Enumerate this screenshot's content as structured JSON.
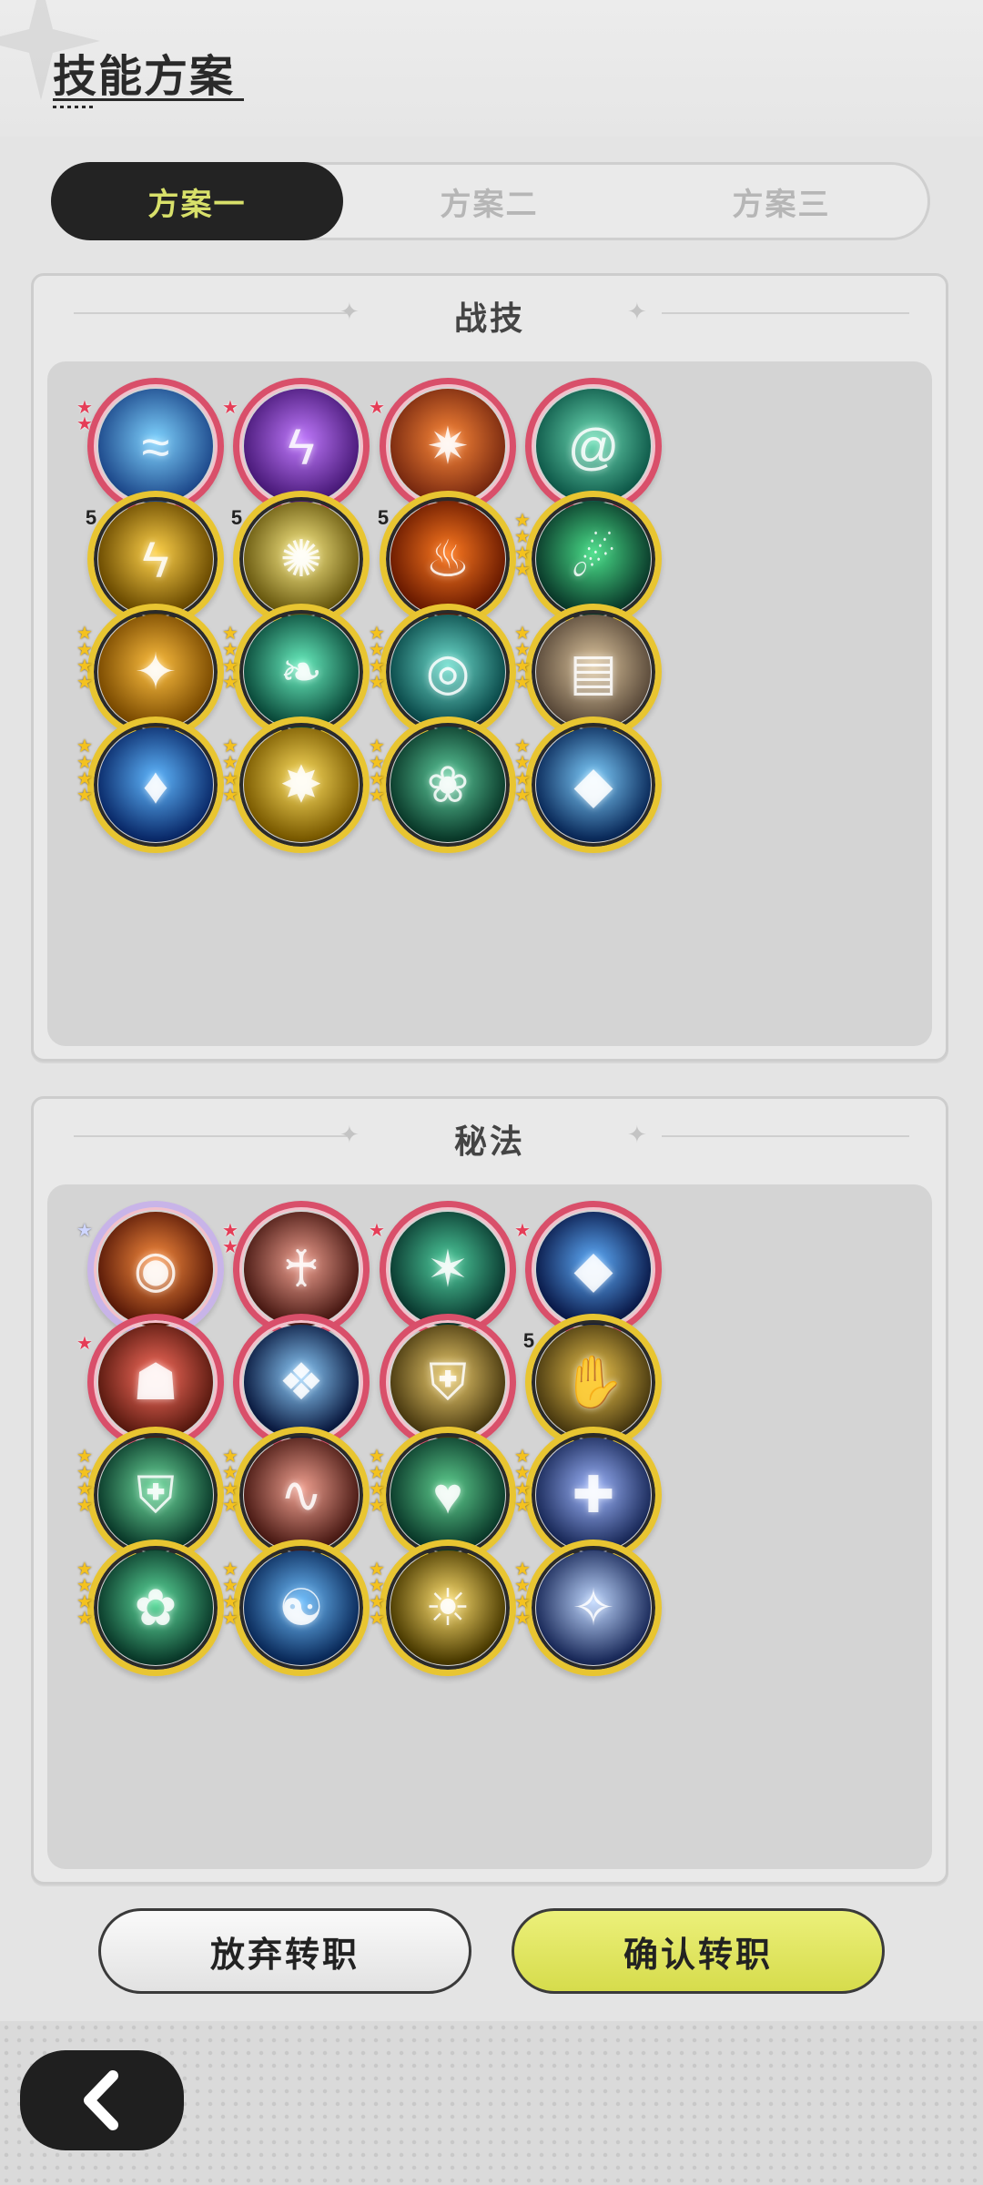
{
  "page": {
    "title": "技能方案"
  },
  "tabs": [
    {
      "label": "方案一",
      "active": true
    },
    {
      "label": "方案二",
      "active": false
    },
    {
      "label": "方案三",
      "active": false
    }
  ],
  "sections": {
    "combat": {
      "title": "战技",
      "skills": [
        {
          "icon": "water-wave-icon",
          "rarity": "red",
          "stars": 2
        },
        {
          "icon": "purple-vortex-icon",
          "rarity": "red",
          "stars": 1
        },
        {
          "icon": "magma-burst-icon",
          "rarity": "red",
          "stars": 1
        },
        {
          "icon": "wind-swirl-icon",
          "rarity": "red",
          "stars": 0
        },
        {
          "icon": "lightning-strike-icon",
          "rarity": "gold",
          "level": "5"
        },
        {
          "icon": "light-orb-icon",
          "rarity": "gold",
          "level": "5"
        },
        {
          "icon": "flame-icon",
          "rarity": "gold",
          "level": "5"
        },
        {
          "icon": "green-comet-icon",
          "rarity": "gold",
          "stars": 4
        },
        {
          "icon": "golden-slash-icon",
          "rarity": "gold",
          "stars": 4
        },
        {
          "icon": "wind-blades-icon",
          "rarity": "gold",
          "stars": 4
        },
        {
          "icon": "cyclone-icon",
          "rarity": "gold",
          "stars": 4
        },
        {
          "icon": "cards-icon",
          "rarity": "gold",
          "stars": 4
        },
        {
          "icon": "blue-fire-icon",
          "rarity": "gold",
          "stars": 4
        },
        {
          "icon": "spark-burst-icon",
          "rarity": "gold",
          "stars": 4
        },
        {
          "icon": "thorn-ring-icon",
          "rarity": "gold",
          "stars": 4
        },
        {
          "icon": "ice-shard-icon",
          "rarity": "gold",
          "stars": 4
        }
      ]
    },
    "arcane": {
      "title": "秘法",
      "skills": [
        {
          "icon": "fire-eye-icon",
          "rarity": "rainbow",
          "stars": 1
        },
        {
          "icon": "heal-figure-icon",
          "rarity": "red",
          "stars": 2
        },
        {
          "icon": "crystal-spikes-icon",
          "rarity": "red",
          "stars": 1
        },
        {
          "icon": "blue-crystal-icon",
          "rarity": "red",
          "stars": 1
        },
        {
          "icon": "demon-mask-icon",
          "rarity": "red",
          "stars": 1
        },
        {
          "icon": "ice-crystal-icon",
          "rarity": "red",
          "stars": 0
        },
        {
          "icon": "golden-shield-icon",
          "rarity": "red",
          "stars": 0
        },
        {
          "icon": "golden-hand-icon",
          "rarity": "gold",
          "level": "5"
        },
        {
          "icon": "green-shield-icon",
          "rarity": "gold",
          "stars": 4
        },
        {
          "icon": "flesh-swirl-icon",
          "rarity": "gold",
          "stars": 4
        },
        {
          "icon": "heart-icon",
          "rarity": "gold",
          "stars": 4
        },
        {
          "icon": "armor-icon",
          "rarity": "gold",
          "stars": 4
        },
        {
          "icon": "clover-icon",
          "rarity": "gold",
          "stars": 4
        },
        {
          "icon": "meditate-water-icon",
          "rarity": "gold",
          "stars": 4
        },
        {
          "icon": "meditate-light-icon",
          "rarity": "gold",
          "stars": 4
        },
        {
          "icon": "sparkle-gem-icon",
          "rarity": "gold",
          "stars": 4
        }
      ]
    }
  },
  "buttons": {
    "abandon": "放弃转职",
    "confirm": "确认转职"
  },
  "colors": {
    "accent_yellow": "#d8e06a",
    "rarity_red": "#d94f6a",
    "rarity_gold": "#e8c531"
  }
}
